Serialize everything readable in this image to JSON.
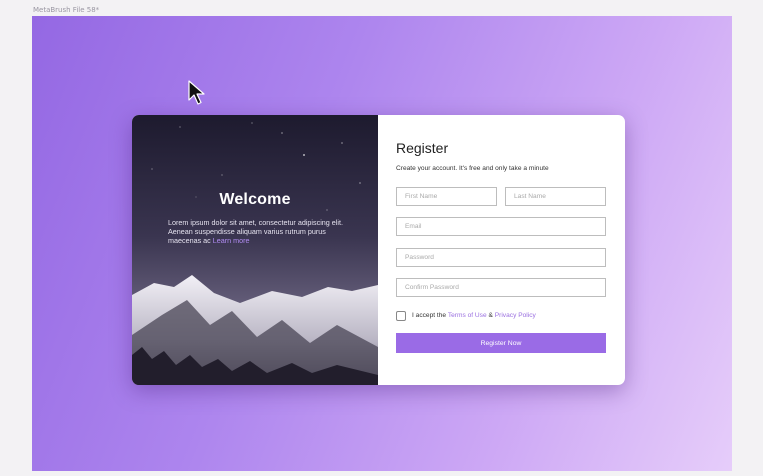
{
  "window": {
    "caption": "MetaBrush File 58*"
  },
  "welcome": {
    "title": "Welcome",
    "body": "Lorem ipsum dolor sit amet, consectetur adipiscing elit. Aenean suspendisse aliquam varius rutrum purus maecenas ac",
    "link": "Learn more"
  },
  "form": {
    "title": "Register",
    "subtitle": "Create your account. It's free and only take a minute",
    "first_name_placeholder": "First Name",
    "last_name_placeholder": "Last Name",
    "email_placeholder": "Email",
    "password_placeholder": "Password",
    "confirm_placeholder": "Confirm Password",
    "terms_prefix": "I accept the",
    "terms_link": "Terms of Use",
    "terms_amp": "&",
    "privacy_link": "Privacy Policy",
    "register_button": "Register Now"
  },
  "colors": {
    "accent": "#9a6be6",
    "link": "#9a6fe0",
    "background_from": "#9468e3",
    "background_to": "#e6cdfa"
  },
  "icons": {
    "cursor": "mouse-pointer-icon"
  }
}
